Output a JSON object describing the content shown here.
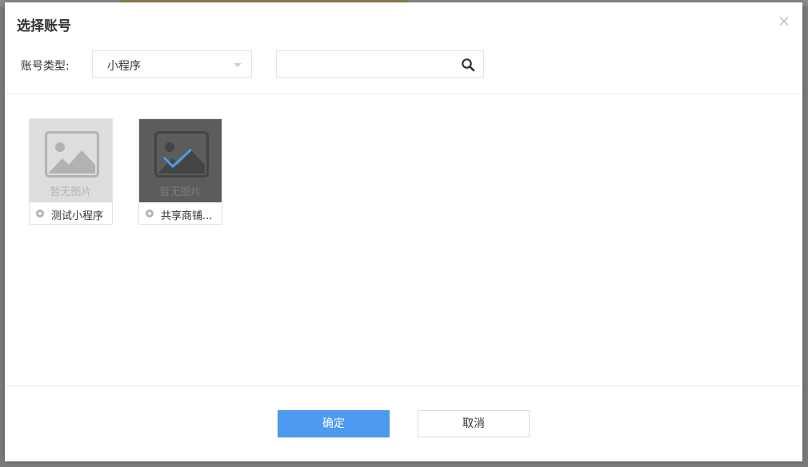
{
  "dialog": {
    "title": "选择账号",
    "close_symbol": "×"
  },
  "filter": {
    "label": "账号类型:",
    "selected_type": "小程序",
    "search_value": "",
    "search_placeholder": ""
  },
  "accounts": [
    {
      "name": "测试小程序",
      "image_text": "暂无图片",
      "selected": false
    },
    {
      "name": "共享商铺...",
      "image_text": "暂无图片",
      "selected": true
    }
  ],
  "footer": {
    "confirm_label": "确定",
    "cancel_label": "取消"
  },
  "colors": {
    "primary": "#4e9af1",
    "check": "#4a9be8"
  },
  "icons": {
    "search": "search-icon",
    "close": "close-icon",
    "dropdown": "chevron-down-icon",
    "placeholder": "image-placeholder-icon",
    "check": "check-icon",
    "mini_app": "mini-program-icon"
  }
}
